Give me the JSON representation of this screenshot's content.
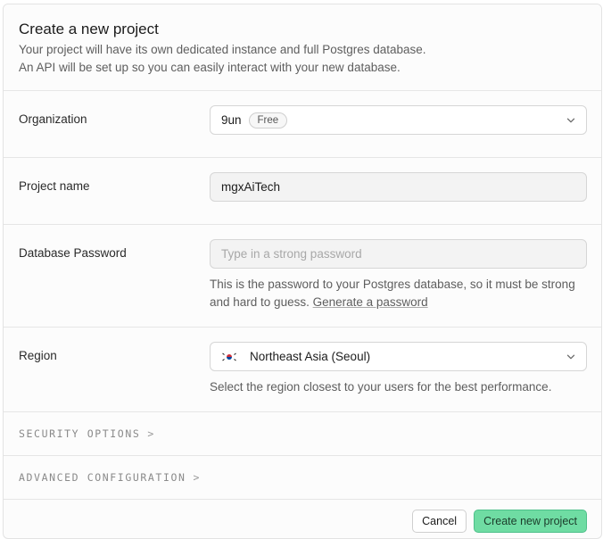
{
  "header": {
    "title": "Create a new project",
    "description_line1": "Your project will have its own dedicated instance and full Postgres database.",
    "description_line2": "An API will be set up so you can easily interact with your new database."
  },
  "organization": {
    "label": "Organization",
    "value": "9un",
    "plan_badge": "Free",
    "icon": "chevron-down-icon"
  },
  "project_name": {
    "label": "Project name",
    "value": "mgxAiTech"
  },
  "database_password": {
    "label": "Database Password",
    "placeholder": "Type in a strong password",
    "help_text": "This is the password to your Postgres database, so it must be strong and hard to guess.",
    "generate_link": "Generate a password"
  },
  "region": {
    "label": "Region",
    "value": "Northeast Asia (Seoul)",
    "flag_icon": "south-korea-flag-icon",
    "help_text": "Select the region closest to your users for the best performance."
  },
  "sections": {
    "security": "SECURITY OPTIONS",
    "advanced": "ADVANCED CONFIGURATION",
    "arrow": ">"
  },
  "footer": {
    "cancel_label": "Cancel",
    "create_label": "Create new project"
  },
  "colors": {
    "primary_button": "#6fdca3",
    "primary_border": "#4ec08a"
  }
}
